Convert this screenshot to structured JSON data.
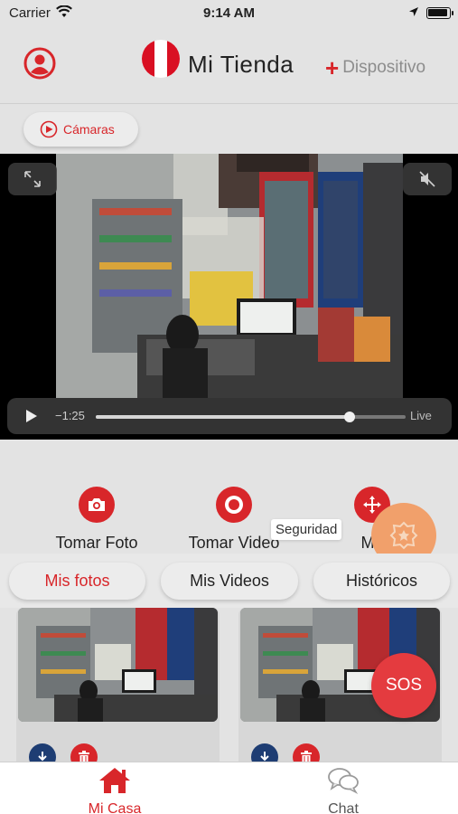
{
  "status_bar": {
    "carrier": "Carrier",
    "time": "9:14 AM"
  },
  "header": {
    "title": "Mi Tienda",
    "add_device_label": "Dispositivo"
  },
  "cameras_button": {
    "label": "Cámaras"
  },
  "player": {
    "time_remaining": "−1:25",
    "live_label": "Live",
    "progress": 0.82
  },
  "actions": {
    "take_photo": "Tomar Foto",
    "take_video": "Tomar Video",
    "move": "Mo",
    "tooltip": "Seguridad"
  },
  "tabs": [
    {
      "label": "Mis fotos",
      "active": true
    },
    {
      "label": "Mis Videos",
      "active": false
    },
    {
      "label": "Históricos",
      "active": false
    }
  ],
  "sos_label": "SOS",
  "bottom_nav": {
    "home": "Mi Casa",
    "chat": "Chat"
  },
  "colors": {
    "accent": "#d8262a",
    "orange_fab": "#f1a06b",
    "download": "#1e3d73"
  }
}
